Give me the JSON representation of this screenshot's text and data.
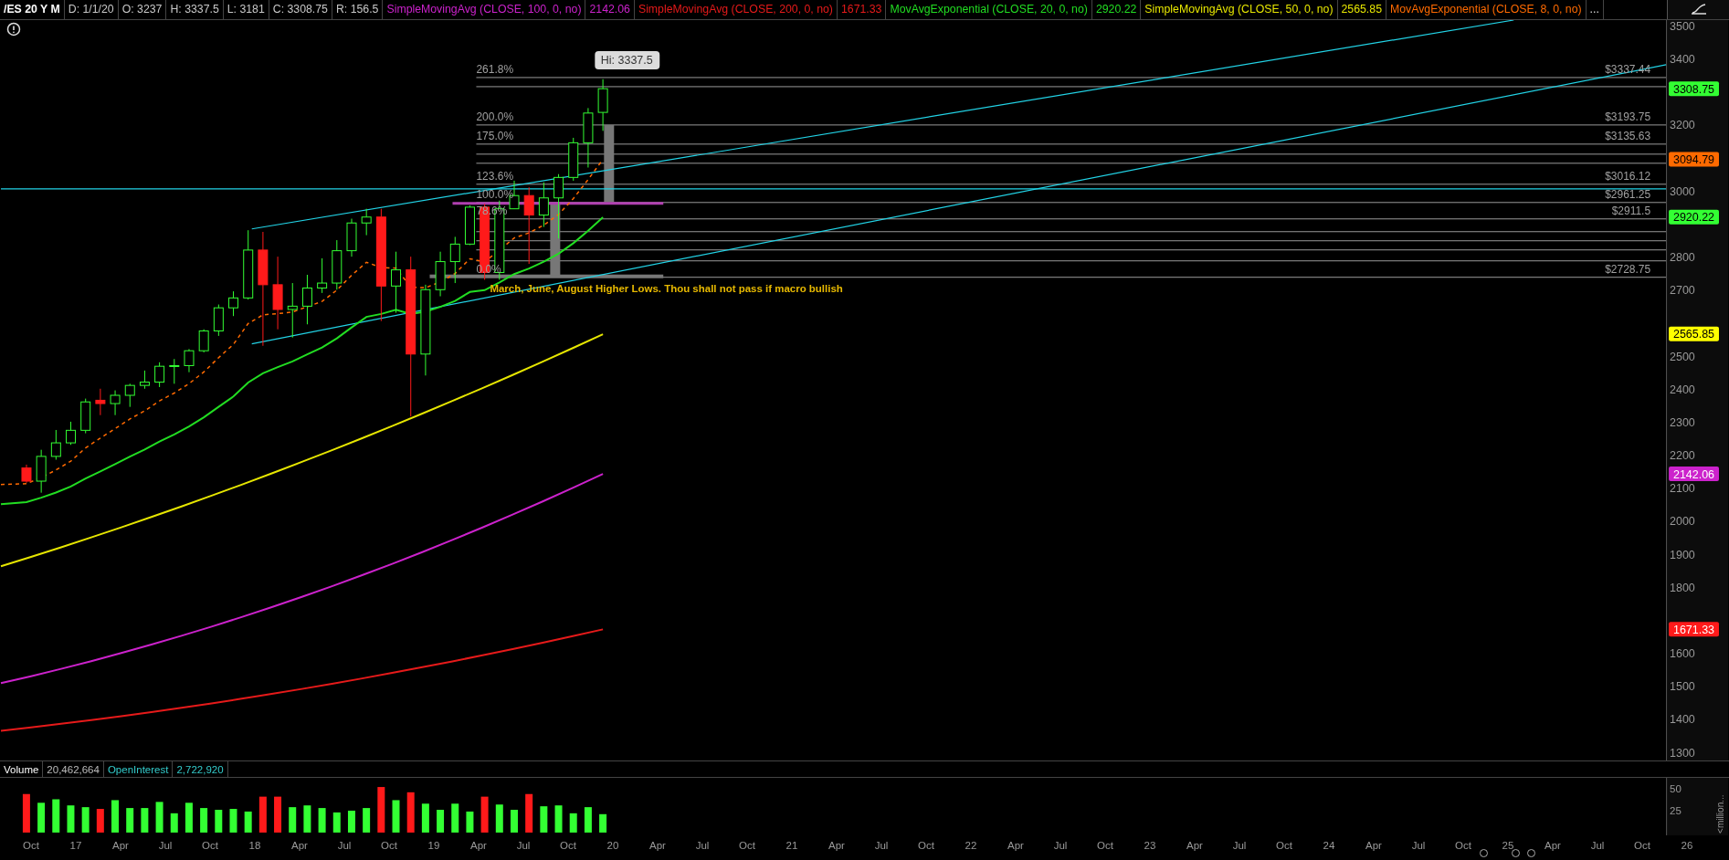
{
  "header": {
    "symbol": "/ES 20 Y M",
    "fields": [
      "D: 1/1/20",
      "O: 3237",
      "H: 3337.5",
      "L: 3181",
      "C: 3308.75",
      "R: 156.5"
    ],
    "studies": [
      {
        "label": "SimpleMovingAvg (CLOSE, 100, 0, no)",
        "value": "2142.06",
        "color": "#cc22cc"
      },
      {
        "label": "SimpleMovingAvg (CLOSE, 200, 0, no)",
        "value": "1671.33",
        "color": "#e61a1a"
      },
      {
        "label": "MovAvgExponential (CLOSE, 20, 0, no)",
        "value": "2920.22",
        "color": "#22dd22"
      },
      {
        "label": "SimpleMovingAvg (CLOSE, 50, 0, no)",
        "value": "2565.85",
        "color": "#e6e600"
      },
      {
        "label": "MovAvgExponential (CLOSE, 8, 0, no)",
        "color": "#ff6a00"
      }
    ],
    "more": "..."
  },
  "price_chart": {
    "high_label": "Hi: 3337.5",
    "fib_levels": [
      {
        "percent": "261.8%",
        "price": "$3337.44"
      },
      {
        "percent": "200.0%",
        "price": "$3193.75"
      },
      {
        "percent": "175.0%",
        "price": "$3135.63"
      },
      {
        "percent": "123.6%",
        "price": "$3016.12"
      },
      {
        "percent": "100.0%",
        "price": "$2961.25"
      },
      {
        "percent": "78.6%",
        "price": "$2911.5"
      },
      {
        "percent": "0.0%",
        "price": "$2728.75"
      }
    ],
    "note": "March, June, August Higher Lows. Thou shall not pass if macro bullish",
    "y_ticks": [
      "3500",
      "3400",
      "3200",
      "3000",
      "2800",
      "2700",
      "2500",
      "2400",
      "2300",
      "2200",
      "2100",
      "2000",
      "1900",
      "1800",
      "1600",
      "1500",
      "1400",
      "1300"
    ],
    "price_badges": [
      {
        "value": "3308.75",
        "color": "#33ff33"
      },
      {
        "value": "3094.79",
        "color": "#ff6a00"
      },
      {
        "value": "2920.22",
        "color": "#33ff33"
      },
      {
        "value": "2565.85",
        "color": "#ffff00"
      },
      {
        "value": "2142.06",
        "color": "#cc22cc"
      },
      {
        "value": "1671.33",
        "color": "#ff1a1a"
      }
    ]
  },
  "volume": {
    "title": "Volume",
    "value": "20,462,664",
    "oi_label": "OpenInterest",
    "oi_value": "2,722,920",
    "y_ticks": [
      "50",
      "25"
    ],
    "unit": "<million..."
  },
  "x_axis": [
    "Oct",
    "17",
    "Apr",
    "Jul",
    "Oct",
    "18",
    "Apr",
    "Jul",
    "Oct",
    "19",
    "Apr",
    "Jul",
    "Oct",
    "20",
    "Apr",
    "Jul",
    "Oct",
    "21",
    "Apr",
    "Jul",
    "Oct",
    "22",
    "Apr",
    "Jul",
    "Oct",
    "23",
    "Apr",
    "Jul",
    "Oct",
    "24",
    "Apr",
    "Jul",
    "Oct",
    "25",
    "Apr",
    "Jul",
    "Oct",
    "26"
  ]
}
